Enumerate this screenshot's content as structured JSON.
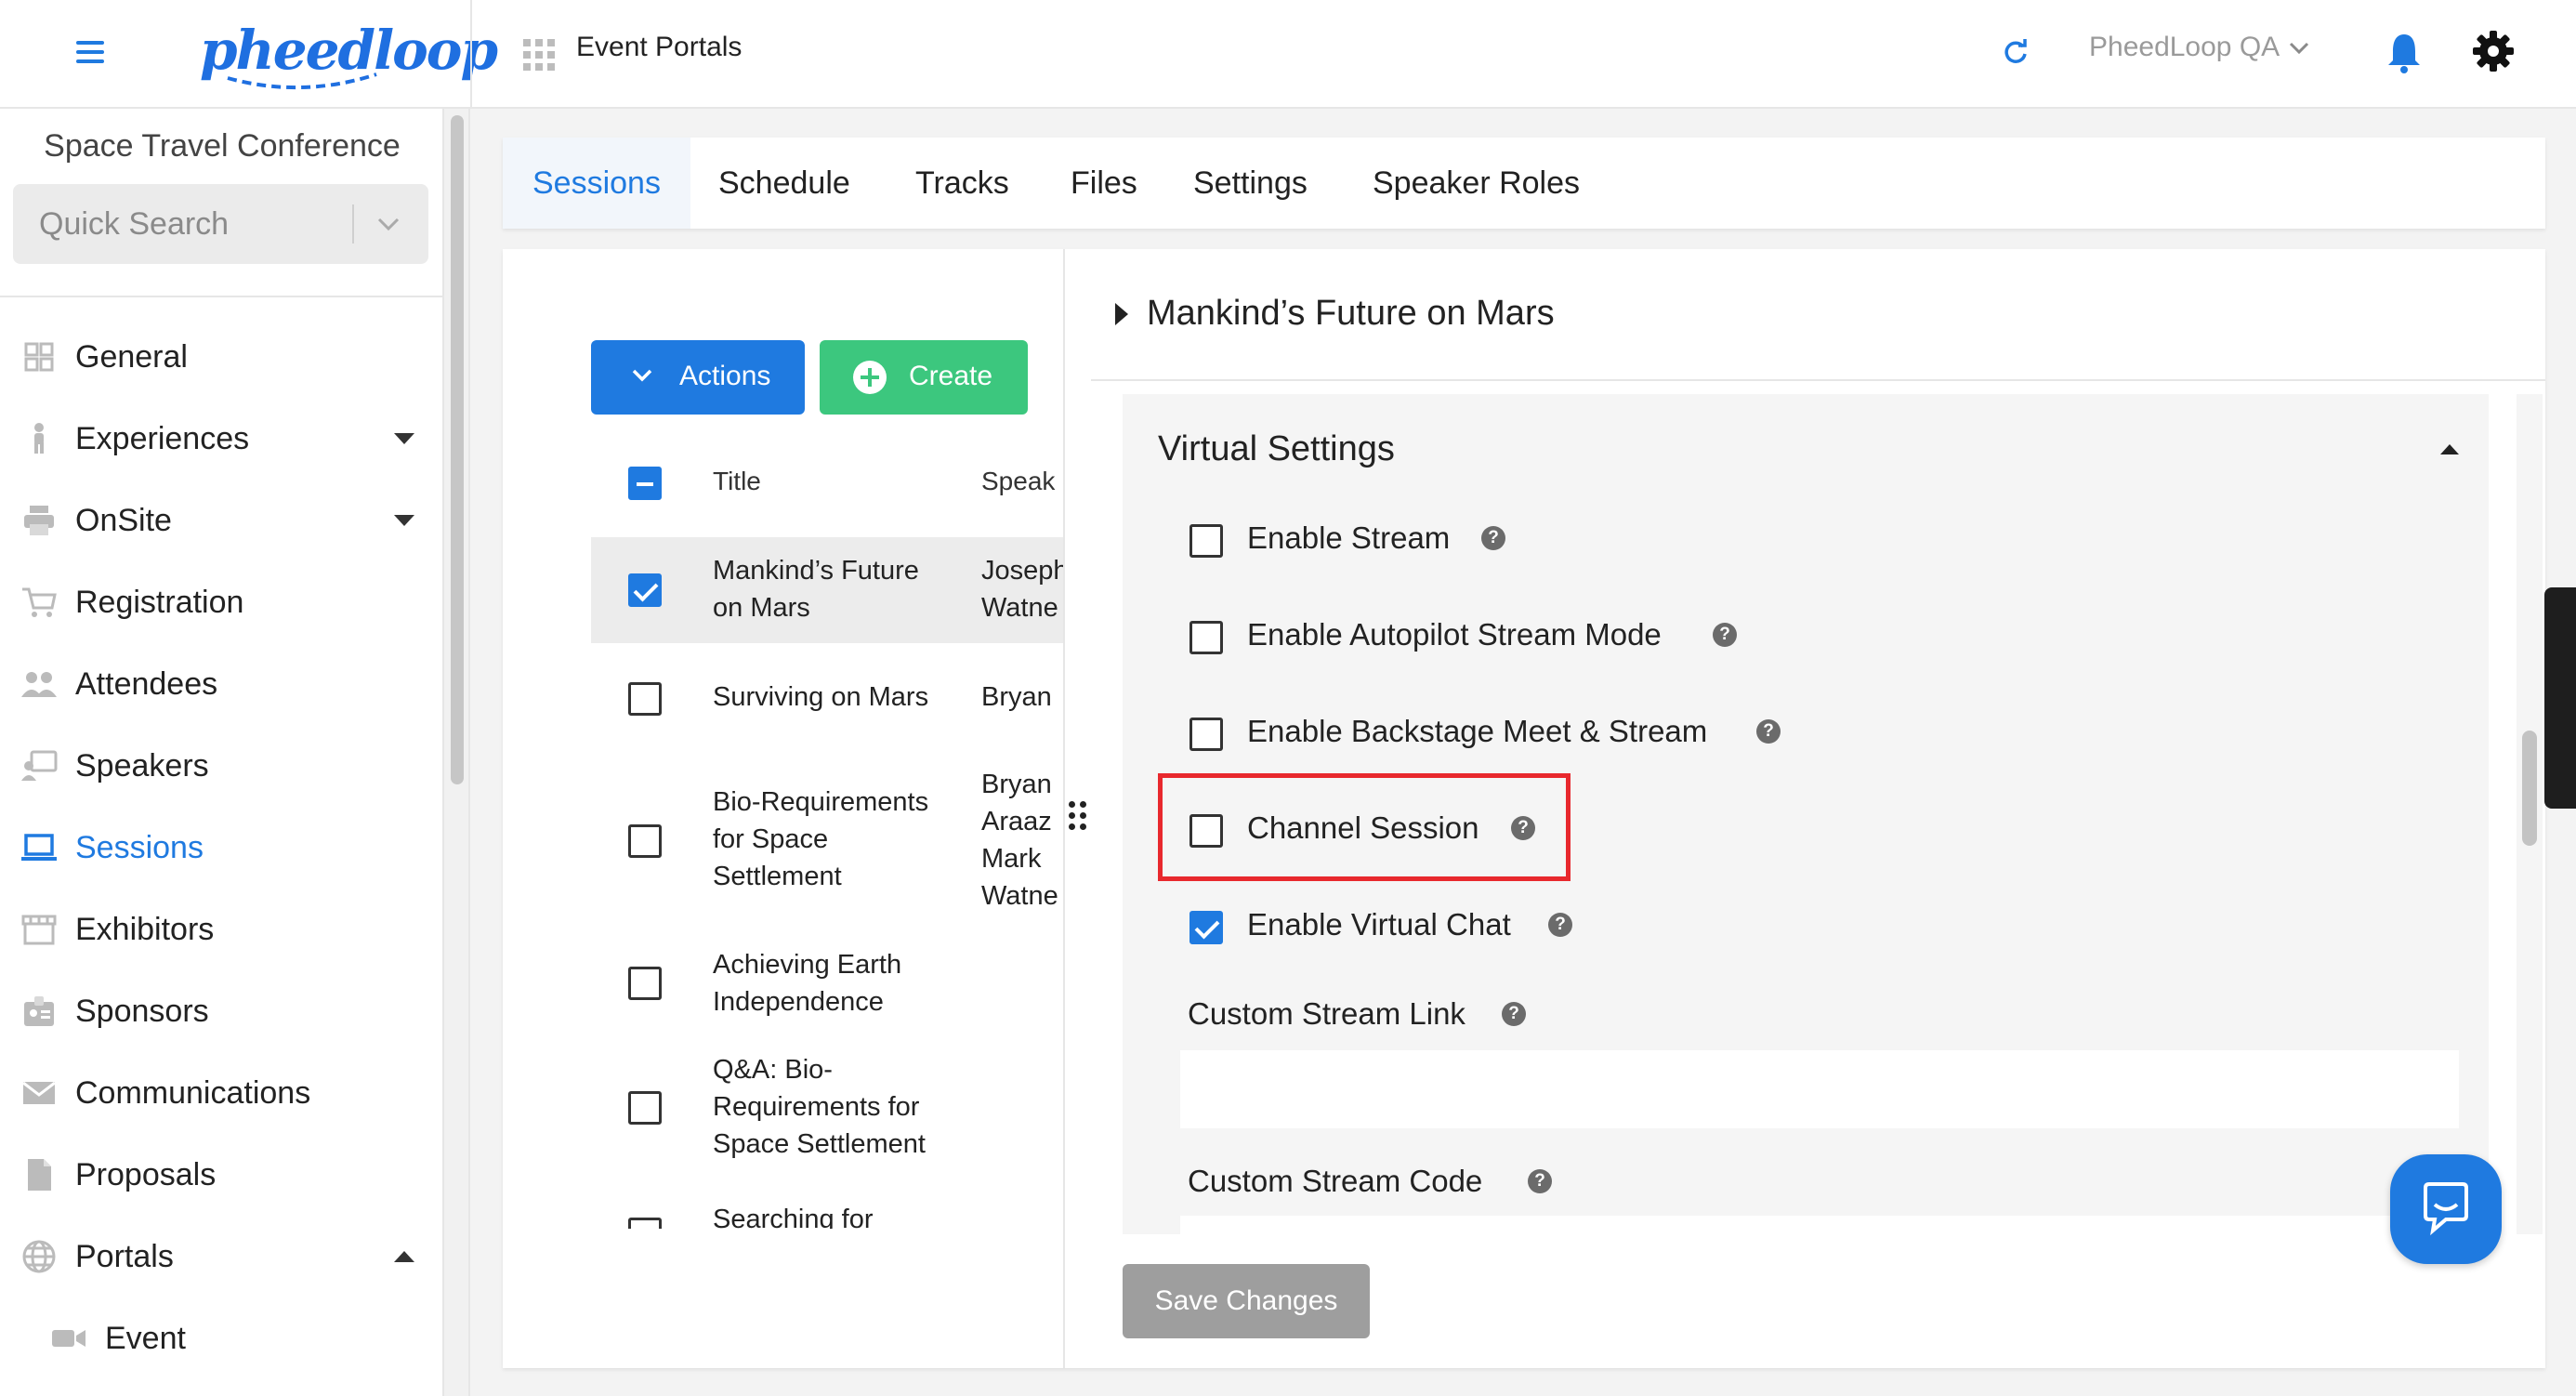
{
  "topbar": {
    "logo_text": "pheedloop",
    "section": "Event Portals",
    "org_name": "PheedLoop QA"
  },
  "sidebar": {
    "conference": "Space Travel Conference",
    "search_placeholder": "Quick Search",
    "items": [
      {
        "label": "General",
        "icon": "grid-icon"
      },
      {
        "label": "Experiences",
        "icon": "person-icon",
        "caret": "down"
      },
      {
        "label": "OnSite",
        "icon": "printer-icon",
        "caret": "down"
      },
      {
        "label": "Registration",
        "icon": "cart-icon"
      },
      {
        "label": "Attendees",
        "icon": "people-icon"
      },
      {
        "label": "Speakers",
        "icon": "presenter-icon"
      },
      {
        "label": "Sessions",
        "icon": "laptop-icon",
        "active": true
      },
      {
        "label": "Exhibitors",
        "icon": "store-icon"
      },
      {
        "label": "Sponsors",
        "icon": "badge-icon"
      },
      {
        "label": "Communications",
        "icon": "envelope-icon"
      },
      {
        "label": "Proposals",
        "icon": "document-icon"
      },
      {
        "label": "Portals",
        "icon": "globe-icon",
        "caret": "up"
      },
      {
        "label": "Event",
        "icon": "video-icon",
        "sub": true
      }
    ]
  },
  "tabs": [
    "Sessions",
    "Schedule",
    "Tracks",
    "Files",
    "Settings",
    "Speaker Roles"
  ],
  "list": {
    "actions_label": "Actions",
    "create_label": "Create",
    "col_title": "Title",
    "col_speaker": "Speak",
    "rows": [
      {
        "title": "Mankind’s Future on Mars",
        "title_lines": [
          "Mankind’s Future",
          "on Mars"
        ],
        "speaker_lines": [
          "Joseph",
          "Watne"
        ],
        "checked": true
      },
      {
        "title_lines": [
          "Surviving on Mars"
        ],
        "speaker_lines": [
          "Bryan"
        ],
        "checked": false
      },
      {
        "title_lines": [
          "Bio-Requirements",
          "for Space",
          "Settlement"
        ],
        "speaker_lines": [
          "Bryan",
          "Araaz",
          "Mark",
          "Watne"
        ],
        "checked": false
      },
      {
        "title_lines": [
          "Achieving Earth",
          "Independence"
        ],
        "speaker_lines": [],
        "checked": false
      },
      {
        "title_lines": [
          "Q&A: Bio-",
          "Requirements for",
          "Space Settlement"
        ],
        "speaker_lines": [],
        "checked": false
      },
      {
        "title_lines": [
          "Searching for"
        ],
        "speaker_lines": [],
        "checked": false
      }
    ]
  },
  "detail": {
    "session_title": "Mankind’s Future on Mars",
    "section_title": "Virtual Settings",
    "options": [
      {
        "label": "Enable Stream",
        "checked": false
      },
      {
        "label": "Enable Autopilot Stream Mode",
        "checked": false
      },
      {
        "label": "Enable Backstage Meet & Stream",
        "checked": false
      },
      {
        "label": "Channel Session",
        "checked": false
      },
      {
        "label": "Enable Virtual Chat",
        "checked": true
      }
    ],
    "custom_stream_link_label": "Custom Stream Link",
    "custom_stream_link_value": "",
    "custom_stream_code_label": "Custom Stream Code",
    "save_label": "Save Changes"
  },
  "colors": {
    "accent": "#1f7ae0",
    "create": "#3cc77e",
    "highlight": "#e8282d"
  }
}
